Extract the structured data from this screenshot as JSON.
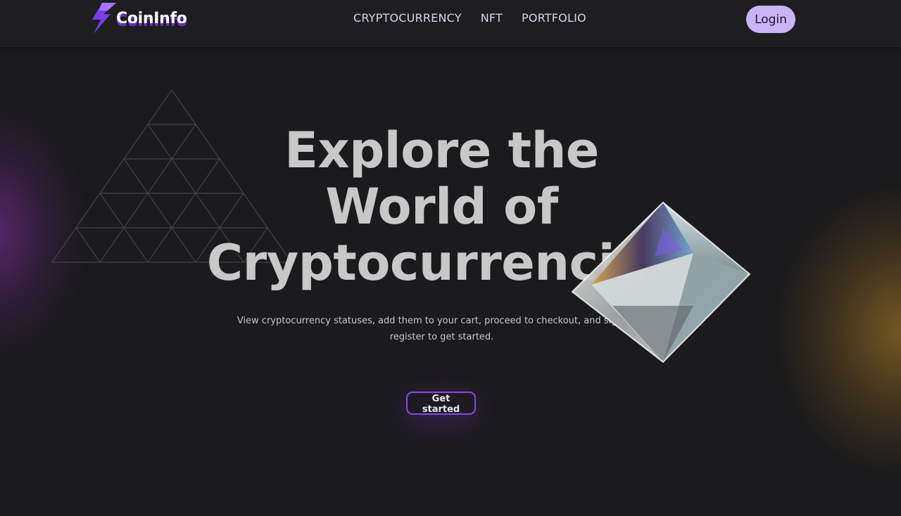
{
  "brand": {
    "name": "CoinInfo",
    "accent": "#6b2fd6"
  },
  "nav": {
    "items": [
      {
        "label": "CRYPTOCURRENCY"
      },
      {
        "label": "NFT"
      },
      {
        "label": "PORTFOLIO"
      }
    ],
    "login_label": "Login"
  },
  "hero": {
    "title_lines": [
      "Explore the",
      "World of",
      "Cryptocurrencies"
    ],
    "subtitle": "View cryptocurrency statuses, add them to your cart, proceed to checkout, and sign in or register to get started.",
    "cta_label": "Get started"
  },
  "colors": {
    "background": "#1b1b1d",
    "login_bg": "#c9b5f5",
    "cta_border": "#8a46e6",
    "glow_left": "#8c32aa",
    "glow_right": "#be8c28"
  }
}
